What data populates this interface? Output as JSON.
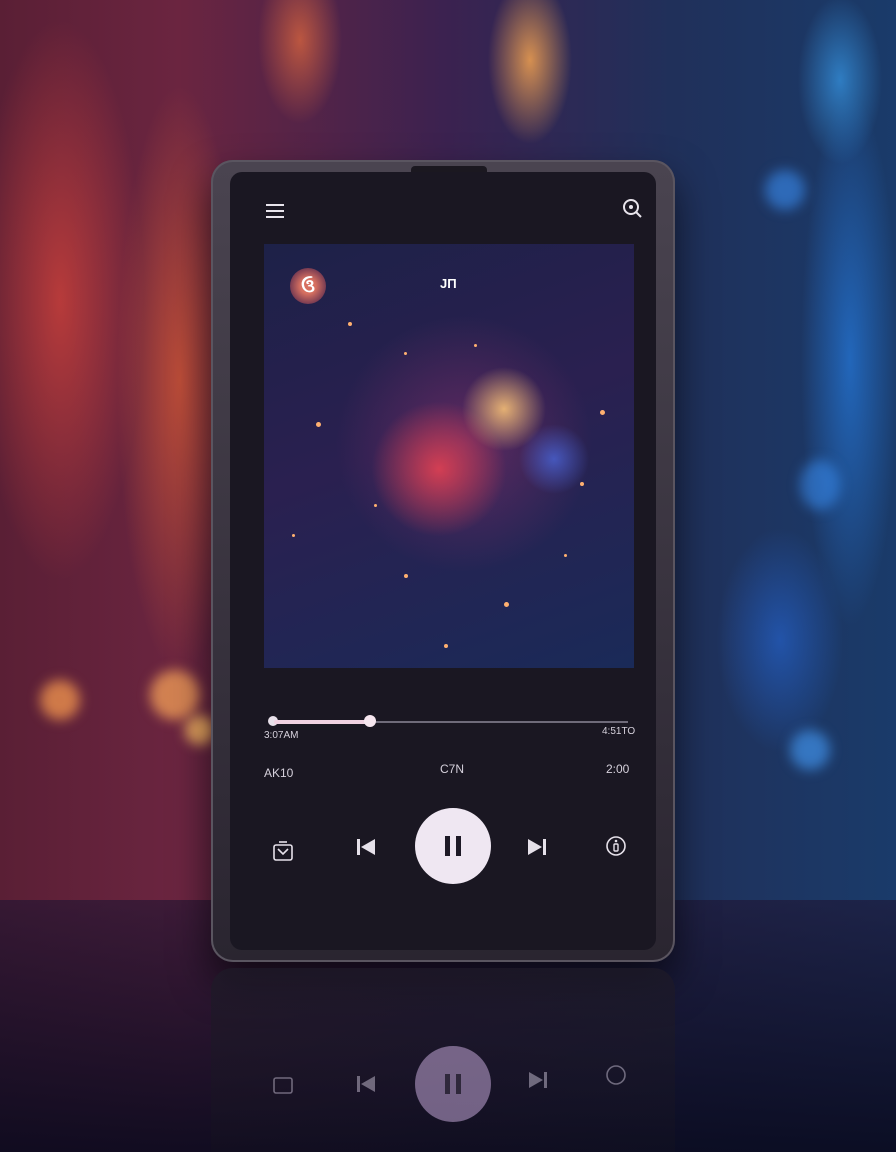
{
  "player": {
    "art_tag": "JΠ",
    "progress_fraction": 0.27,
    "time_left_label": "3:07AM",
    "time_right_label": "4:51TO",
    "info_left": "AK10",
    "info_center": "C7N",
    "info_right": "2:00",
    "state": "playing"
  },
  "icons": {
    "menu": "menu-icon",
    "search": "search-icon",
    "queue": "queue-icon",
    "previous": "skip-previous-icon",
    "pause": "pause-icon",
    "next": "skip-next-icon",
    "info": "info-icon"
  },
  "colors": {
    "accent": "#f1d2e2",
    "screen_bg": "#1a1722",
    "play_button": "#efe7f2"
  }
}
